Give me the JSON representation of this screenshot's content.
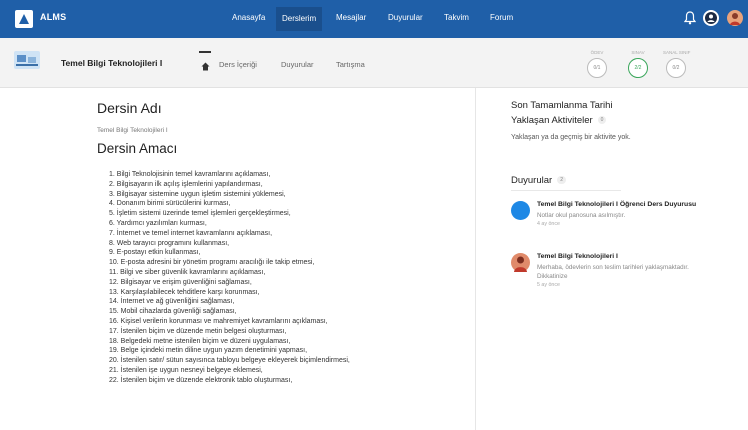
{
  "app": {
    "brand": "ALMS",
    "nav": [
      "Anasayfa",
      "Derslerim",
      "Mesajlar",
      "Duyurular",
      "Takvim",
      "Forum"
    ],
    "active_nav": "Derslerim",
    "accent": "#1f5fa8"
  },
  "course": {
    "title": "Temel Bilgi Teknolojileri I",
    "tabs": [
      "Ders İçeriği",
      "Duyurular",
      "Tartışma"
    ],
    "progress": [
      {
        "label": "ÖDEV",
        "value": "0/1"
      },
      {
        "label": "SINAV",
        "value": "2/2"
      },
      {
        "label": "SANAL SINIF",
        "value": "0/2"
      }
    ]
  },
  "main": {
    "heading": "Dersin Adı",
    "course_name": "Temel Bilgi Teknolojileri I",
    "purpose_heading": "Dersin Amacı",
    "objectives": [
      "1. Bilgi Teknolojisinin temel kavramlarını açıklaması,",
      "2. Bilgisayarın ilk açılış işlemlerini yapılandırması,",
      "3. Bilgisayar sistemine uygun işletim sistemini yüklemesi,",
      "4. Donanım birimi sürücülerini kurması,",
      "5. İşletim sistemi üzerinde temel işlemleri gerçekleştirmesi,",
      "6. Yardımcı yazılımları kurması,",
      "7. İnternet ve temel internet kavramlarını açıklaması,",
      "8. Web tarayıcı programını kullanması,",
      "9. E-postayı etkin kullanması,",
      "10. E-posta adresini bir yönetim programı aracılığı ile takip etmesi,",
      "11. Bilgi ve siber güvenlik kavramlarını açıklaması,",
      "12. Bilgisayar ve erişim güvenliğini sağlaması,",
      "13. Karşılaşılabilecek tehditlere karşı korunması,",
      "14. İnternet ve ağ güvenliğini sağlaması,",
      "15. Mobil cihazlarda güvenliği sağlaması,",
      "16. Kişisel verilerin korunması ve mahremiyet kavramlarını açıklaması,",
      "17. İstenilen biçim ve düzende metin belgesi oluşturması,",
      "18. Belgedeki metne istenilen biçim ve düzeni uygulaması,",
      "19. Belge içindeki metin diline uygun yazım denetimini yapması,",
      "20. İstenilen satır/ sütun sayısınca tabloyu belgeye ekleyerek biçimlendirmesi,",
      "21. İstenilen işe uygun nesneyi belgeye eklemesi,",
      "22. İstenilen biçim ve düzende elektronik tablo oluşturması,"
    ]
  },
  "sidebar": {
    "completion_title": "Son Tamamlanma Tarihi",
    "upcoming_title": "Yaklaşan Aktiviteler",
    "upcoming_count": "0",
    "upcoming_empty": "Yaklaşan ya da geçmiş bir aktivite yok.",
    "announcements_title": "Duyurular",
    "announcements_count": "2",
    "announcements": [
      {
        "title": "Temel Bilgi Teknolojileri I Öğrenci Ders Duyurusu",
        "text": "Notlar okul panosuna asılmıştır.",
        "time": "4 ay önce"
      },
      {
        "title": "Temel Bilgi Teknolojileri I",
        "text": "Merhaba, ödevlerin son teslim tarihleri yaklaşmaktadır. Dikkatinize",
        "time": "5 ay önce"
      }
    ]
  }
}
